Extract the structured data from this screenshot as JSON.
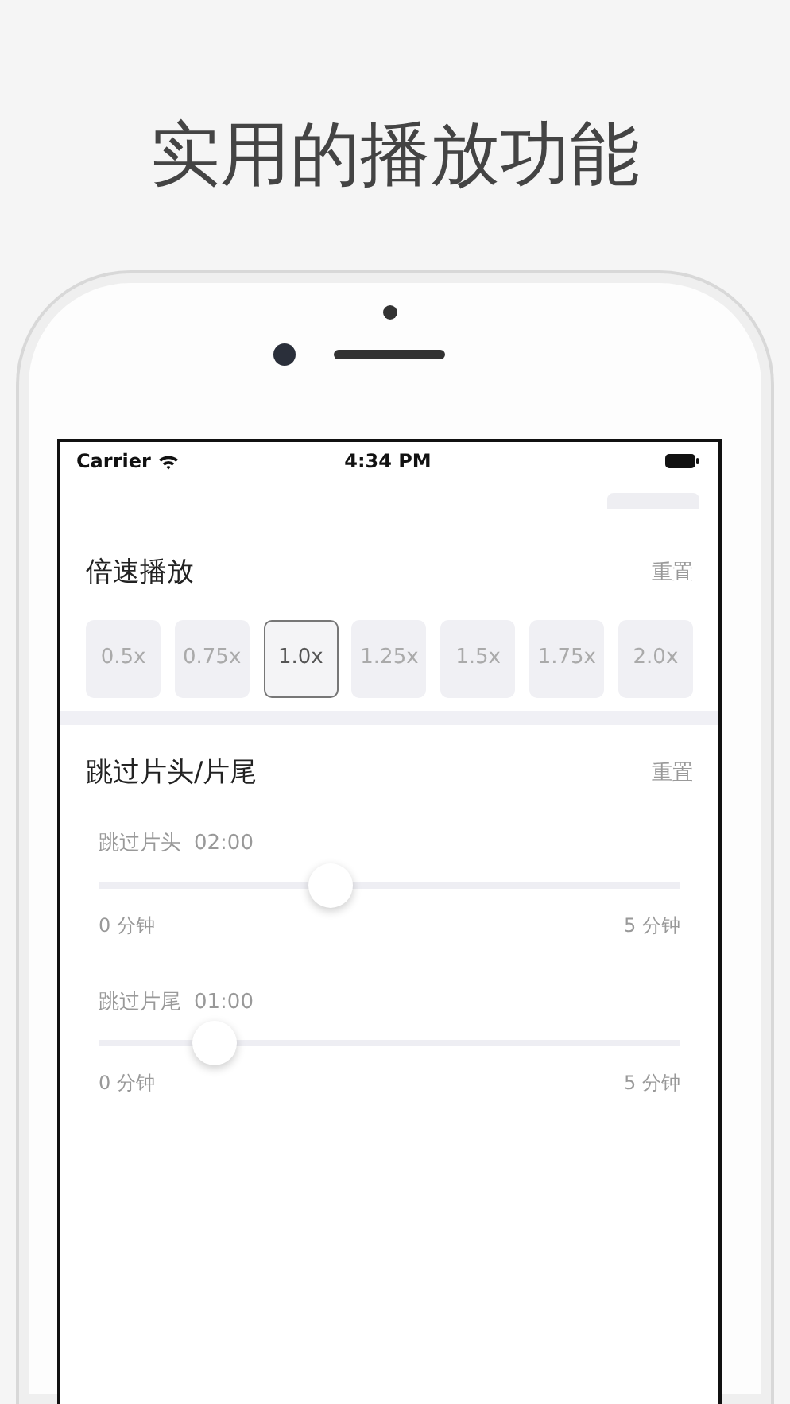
{
  "headline": "实用的播放功能",
  "status_bar": {
    "carrier": "Carrier",
    "time": "4:34 PM"
  },
  "speed": {
    "title": "倍速播放",
    "reset": "重置",
    "options": [
      {
        "label": "0.5x",
        "selected": false
      },
      {
        "label": "0.75x",
        "selected": false
      },
      {
        "label": "1.0x",
        "selected": true
      },
      {
        "label": "1.25x",
        "selected": false
      },
      {
        "label": "1.5x",
        "selected": false
      },
      {
        "label": "1.75x",
        "selected": false
      },
      {
        "label": "2.0x",
        "selected": false
      }
    ]
  },
  "skip": {
    "title": "跳过片头/片尾",
    "reset": "重置",
    "sliders": [
      {
        "label": "跳过片头",
        "value": "02:00",
        "level": 0.4,
        "min": "0 分钟",
        "max": "5 分钟"
      },
      {
        "label": "跳过片尾",
        "value": "01:00",
        "level": 0.2,
        "min": "0 分钟",
        "max": "5 分钟"
      }
    ]
  }
}
